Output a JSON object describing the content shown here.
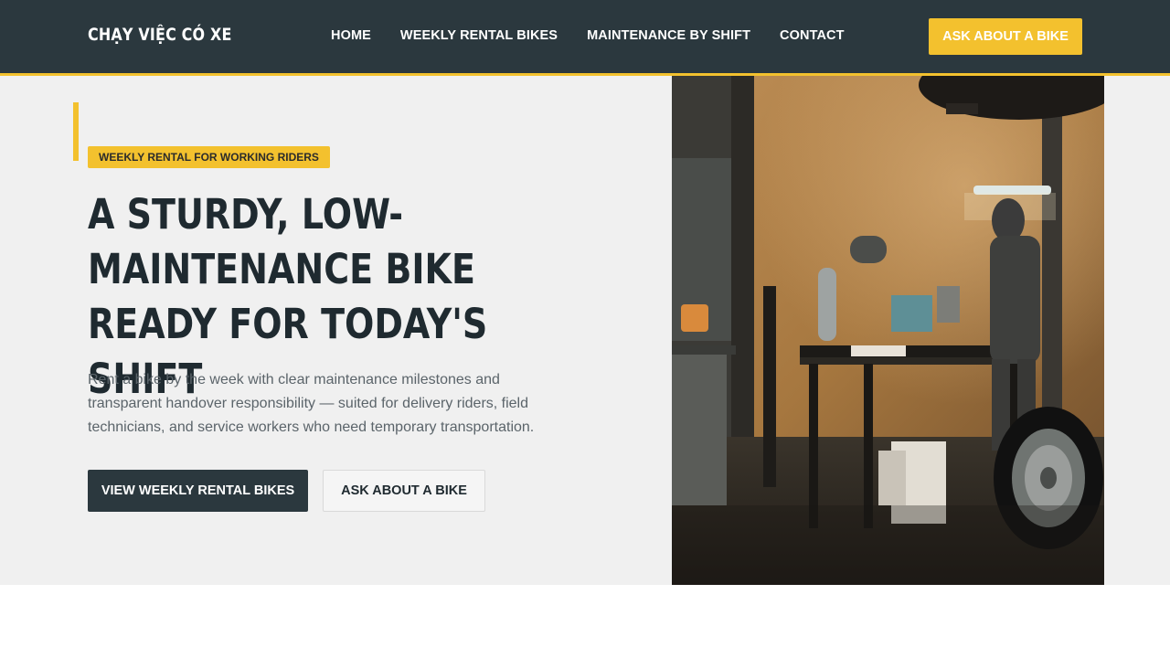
{
  "header": {
    "brand": "CHẠY VIỆC CÓ XE",
    "nav": [
      {
        "label": "HOME"
      },
      {
        "label": "WEEKLY RENTAL BIKES"
      },
      {
        "label": "MAINTENANCE BY SHIFT"
      },
      {
        "label": "CONTACT"
      }
    ],
    "cta_label": "ASK ABOUT A BIKE"
  },
  "hero": {
    "eyebrow": "WEEKLY RENTAL FOR WORKING RIDERS",
    "headline": "A STURDY, LOW-MAINTENANCE BIKE READY FOR TODAY'S SHIFT",
    "lead": "Rent a bike by the week with clear maintenance milestones and transparent handover responsibility — suited for delivery riders, field technicians, and service workers who need temporary transportation.",
    "primary_label": "VIEW WEEKLY RENTAL BIKES",
    "secondary_label": "ASK ABOUT A BIKE"
  },
  "colors": {
    "header_bg": "#2b383e",
    "accent": "#f3c12e",
    "hero_bg": "#f0f0f0",
    "primary_button": "#2b383e"
  }
}
